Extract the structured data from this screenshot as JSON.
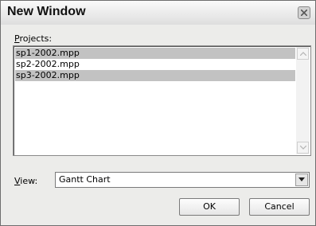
{
  "window": {
    "title": "New Window"
  },
  "projects": {
    "label_underlined": "P",
    "label_rest": "rojects:",
    "items": [
      {
        "label": "sp1-2002.mpp",
        "selected": true
      },
      {
        "label": "sp2-2002.mpp",
        "selected": false
      },
      {
        "label": "sp3-2002.mpp",
        "selected": true
      }
    ]
  },
  "view": {
    "label_underlined": "V",
    "label_rest": "iew:",
    "selected": "Gantt Chart"
  },
  "buttons": {
    "ok": "OK",
    "cancel": "Cancel"
  },
  "colors": {
    "selection": "#c2c2c2",
    "dialog_bg": "#ececea"
  }
}
